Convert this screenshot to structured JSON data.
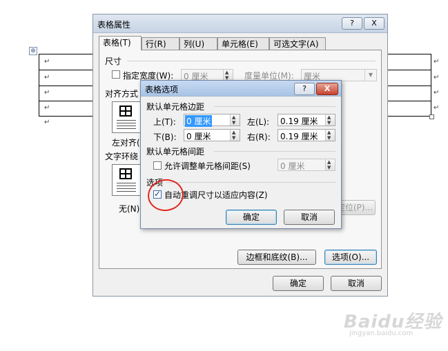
{
  "background_doc": {
    "para_mark": "↵",
    "move_handle": "⊕"
  },
  "table_props": {
    "title": "表格属性",
    "help_btn": "?",
    "close_btn": "X",
    "tabs": [
      "表格(T)",
      "行(R)",
      "列(U)",
      "单元格(E)",
      "可选文字(A)"
    ],
    "size_header": "尺寸",
    "preferred_width_label": "指定宽度(W):",
    "preferred_width_value": "0 厘米",
    "measure_in_label": "度量单位(M):",
    "measure_in_value": "厘米",
    "alignment_header": "对齐方式",
    "align_left_label": "左对齐(",
    "wrapping_header": "文字环绕",
    "wrap_none_label": "无(N)",
    "positioning_btn": "定位(P)...",
    "borders_btn": "边框和底纹(B)...",
    "options_btn": "选项(O)...",
    "ok": "确定",
    "cancel": "取消"
  },
  "table_options": {
    "title": "表格选项",
    "help_btn": "?",
    "close_btn": "X",
    "default_margins_header": "默认单元格边距",
    "top_label": "上(T):",
    "top_value": "0 厘米",
    "left_label": "左(L):",
    "left_value": "0.19 厘米",
    "bottom_label": "下(B):",
    "bottom_value": "0 厘米",
    "right_label": "右(R):",
    "right_value": "0.19 厘米",
    "default_spacing_header": "默认单元格间距",
    "allow_spacing_label": "允许调整单元格间距(S)",
    "allow_spacing_value": "0 厘米",
    "options_header": "选项",
    "autoresize_label": "自动重调尺寸以适应内容(Z)",
    "autoresize_checked": true,
    "ok": "确定",
    "cancel": "取消"
  },
  "watermark": {
    "brand": "Baidu经验",
    "url": "jingyan.baidu.com"
  },
  "colors": {
    "annotation": "#e0261d",
    "selection": "#3399ff"
  }
}
